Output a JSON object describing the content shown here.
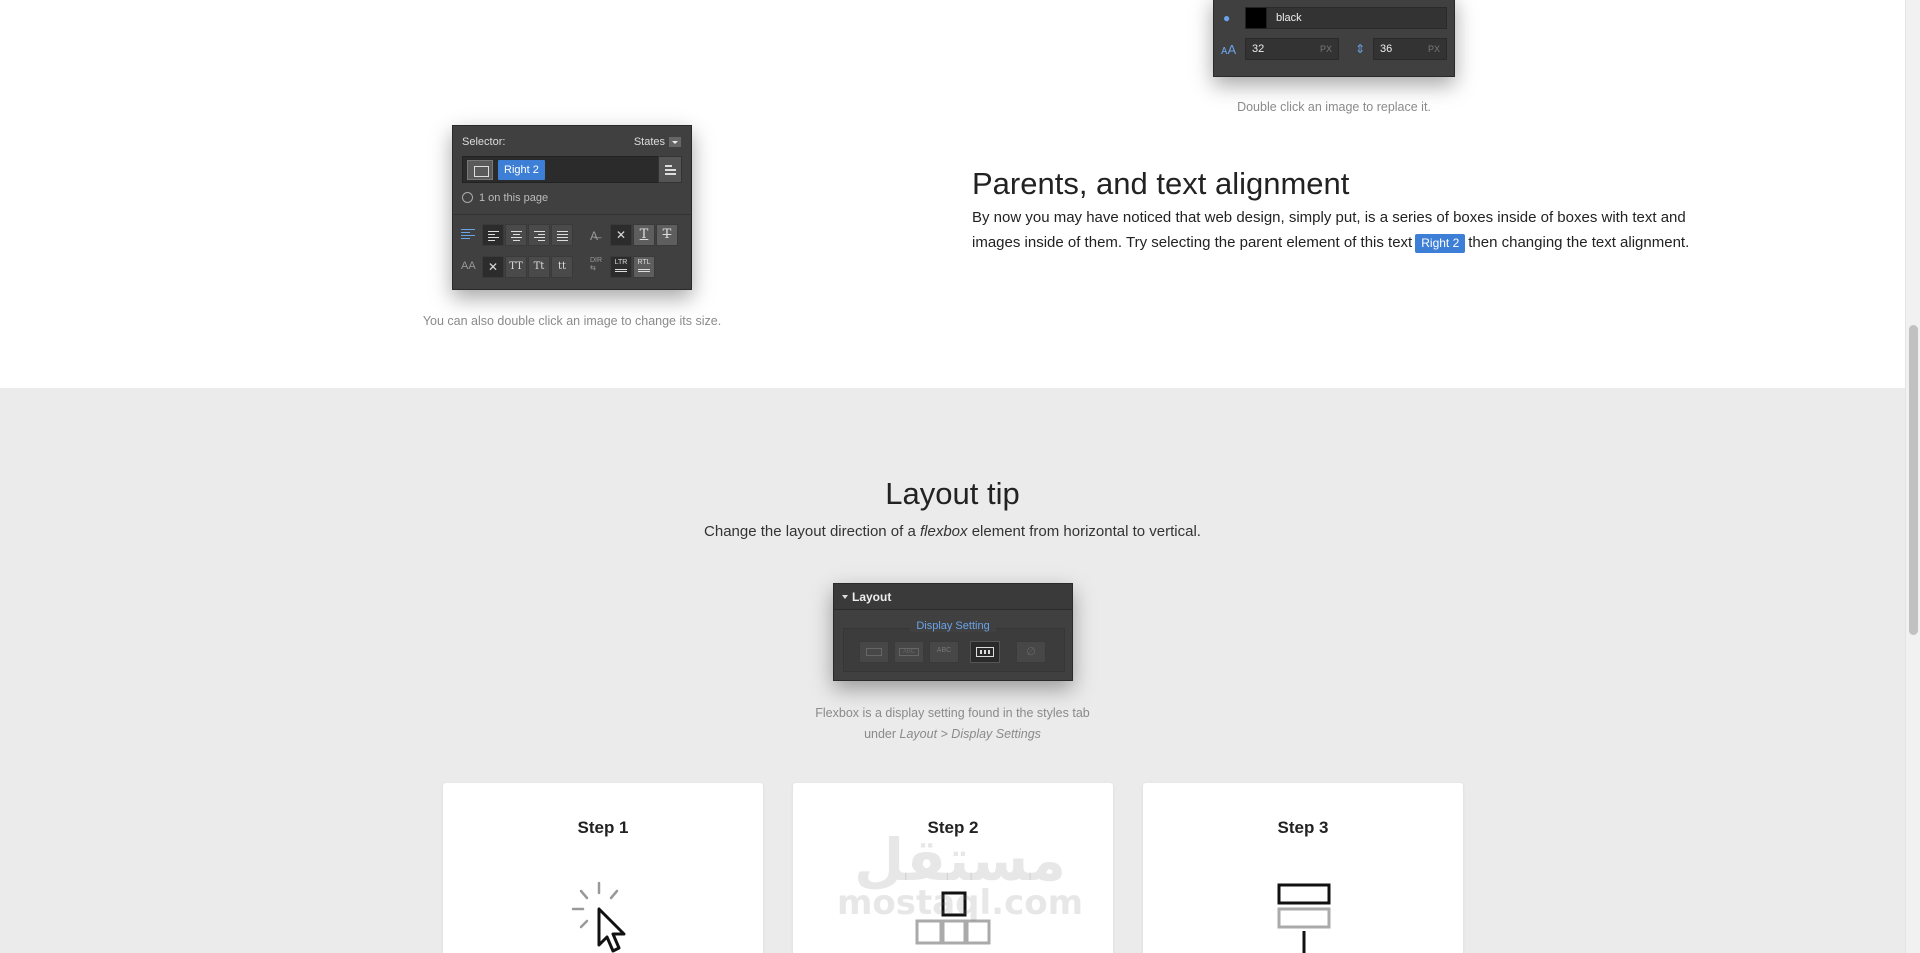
{
  "typography_panel": {
    "color_value": "black",
    "font_size": "32",
    "font_size_unit": "PX",
    "line_height": "36",
    "line_height_unit": "PX"
  },
  "caption_replace": "Double click an image to replace it.",
  "selector_panel": {
    "title": "Selector:",
    "states_label": "States",
    "selected_class": "Right 2",
    "count_text": "1 on this page",
    "case_buttons": [
      "TT",
      "Tt",
      "tt"
    ],
    "dir_label": "DIR",
    "ltr_label": "LTR",
    "rtl_label": "RTL",
    "case_label": "AA"
  },
  "caption_resize": "You can also double click an image to change its size.",
  "parents_section": {
    "heading": "Parents, and text alignment",
    "paragraph_before": "By now you may have noticed that web design, simply put, is a series of boxes inside of boxes with text and images inside of them. Try selecting the parent element of this text",
    "chip": "Right 2",
    "paragraph_after": "then changing the text alignment."
  },
  "layout_tip": {
    "title": "Layout tip",
    "subtitle_before": "Change the layout direction of a",
    "subtitle_em": "flexbox",
    "subtitle_after": "element from horizontal to vertical.",
    "panel_header": "Layout",
    "display_setting_label": "Display Setting",
    "caption_line1": "Flexbox is a display setting found in the styles tab",
    "caption_line2_prefix": "under",
    "caption_line2_em": "Layout > Display Settings"
  },
  "steps": [
    {
      "title": "Step 1"
    },
    {
      "title": "Step 2"
    },
    {
      "title": "Step 3"
    }
  ],
  "watermark": {
    "arabic": "مستقل",
    "latin": "mostaql.com"
  },
  "colors": {
    "accent_blue": "#3d7fd6",
    "panel_dark": "#404040",
    "section_grey": "#ebebeb"
  }
}
